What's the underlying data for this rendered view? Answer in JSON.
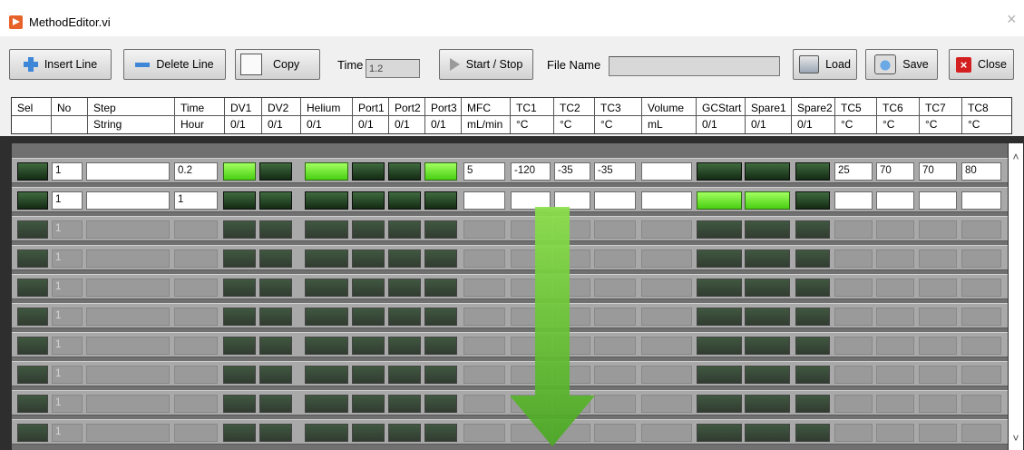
{
  "window": {
    "title": "MethodEditor.vi",
    "close_glyph": "×"
  },
  "toolbar": {
    "insert_line": "Insert Line",
    "delete_line": "Delete Line",
    "copy": "Copy",
    "time_label": "Time",
    "time_value": "1.2",
    "start_stop": "Start / Stop",
    "file_name_label": "File Name",
    "file_name_value": "",
    "load": "Load",
    "save": "Save",
    "close": "Close"
  },
  "icons": {
    "insert": "plus-icon",
    "delete": "minus-icon",
    "copy": "blank-square-icon",
    "start_stop": "play-triangle-icon",
    "load": "folder-icon",
    "save": "disk-save-icon",
    "close": "red-x-icon"
  },
  "columns": [
    {
      "name": "Sel",
      "unit": "",
      "kind": "led"
    },
    {
      "name": "No",
      "unit": "",
      "kind": "text"
    },
    {
      "name": "Step",
      "unit": "String",
      "kind": "text"
    },
    {
      "name": "Time",
      "unit": "Hour",
      "kind": "text"
    },
    {
      "name": "DV1",
      "unit": "0/1",
      "kind": "led"
    },
    {
      "name": "DV2",
      "unit": "0/1",
      "kind": "led"
    },
    {
      "name": "Helium",
      "unit": "0/1",
      "kind": "led"
    },
    {
      "name": "Port1",
      "unit": "0/1",
      "kind": "led"
    },
    {
      "name": "Port2",
      "unit": "0/1",
      "kind": "led"
    },
    {
      "name": "Port3",
      "unit": "0/1",
      "kind": "led"
    },
    {
      "name": "MFC",
      "unit": "mL/min",
      "kind": "text"
    },
    {
      "name": "TC1",
      "unit": "°C",
      "kind": "text"
    },
    {
      "name": "TC2",
      "unit": "°C",
      "kind": "text"
    },
    {
      "name": "TC3",
      "unit": "°C",
      "kind": "text"
    },
    {
      "name": "Volume",
      "unit": "mL",
      "kind": "text"
    },
    {
      "name": "GCStart",
      "unit": "0/1",
      "kind": "led"
    },
    {
      "name": "Spare1",
      "unit": "0/1",
      "kind": "led"
    },
    {
      "name": "Spare2",
      "unit": "0/1",
      "kind": "led"
    },
    {
      "name": "TC5",
      "unit": "°C",
      "kind": "text"
    },
    {
      "name": "TC6",
      "unit": "°C",
      "kind": "text"
    },
    {
      "name": "TC7",
      "unit": "°C",
      "kind": "text"
    },
    {
      "name": "TC8",
      "unit": "°C",
      "kind": "text"
    }
  ],
  "rows": [
    {
      "values": [
        0,
        "1",
        "",
        "0.2",
        1,
        0,
        1,
        0,
        0,
        1,
        "5",
        "-120",
        "-35",
        "-35",
        "",
        0,
        0,
        0,
        "25",
        "70",
        "70",
        "80"
      ],
      "active": true
    },
    {
      "values": [
        0,
        "1",
        "",
        "1",
        0,
        0,
        0,
        0,
        0,
        0,
        "",
        "",
        "",
        "",
        "",
        1,
        1,
        0,
        "",
        "",
        "",
        ""
      ],
      "active": true
    },
    {
      "values": [
        0,
        "1",
        "",
        "",
        0,
        0,
        0,
        0,
        0,
        0,
        "",
        "",
        "",
        "",
        "",
        0,
        0,
        0,
        "",
        "",
        "",
        ""
      ],
      "active": false
    },
    {
      "values": [
        0,
        "1",
        "",
        "",
        0,
        0,
        0,
        0,
        0,
        0,
        "",
        "",
        "",
        "",
        "",
        0,
        0,
        0,
        "",
        "",
        "",
        ""
      ],
      "active": false
    },
    {
      "values": [
        0,
        "1",
        "",
        "",
        0,
        0,
        0,
        0,
        0,
        0,
        "",
        "",
        "",
        "",
        "",
        0,
        0,
        0,
        "",
        "",
        "",
        ""
      ],
      "active": false
    },
    {
      "values": [
        0,
        "1",
        "",
        "",
        0,
        0,
        0,
        0,
        0,
        0,
        "",
        "",
        "",
        "",
        "",
        0,
        0,
        0,
        "",
        "",
        "",
        ""
      ],
      "active": false
    },
    {
      "values": [
        0,
        "1",
        "",
        "",
        0,
        0,
        0,
        0,
        0,
        0,
        "",
        "",
        "",
        "",
        "",
        0,
        0,
        0,
        "",
        "",
        "",
        ""
      ],
      "active": false
    },
    {
      "values": [
        0,
        "1",
        "",
        "",
        0,
        0,
        0,
        0,
        0,
        0,
        "",
        "",
        "",
        "",
        "",
        0,
        0,
        0,
        "",
        "",
        "",
        ""
      ],
      "active": false
    },
    {
      "values": [
        0,
        "1",
        "",
        "",
        0,
        0,
        0,
        0,
        0,
        0,
        "",
        "",
        "",
        "",
        "",
        0,
        0,
        0,
        "",
        "",
        "",
        ""
      ],
      "active": false
    },
    {
      "values": [
        0,
        "1",
        "",
        "",
        0,
        0,
        0,
        0,
        0,
        0,
        "",
        "",
        "",
        "",
        "",
        0,
        0,
        0,
        "",
        "",
        "",
        ""
      ],
      "active": false
    }
  ],
  "scrollbar": {
    "up_glyph": "˄",
    "down_glyph": "˅"
  },
  "colors": {
    "led_on": "#6be82a",
    "led_off": "#1f3a1f",
    "arrow": "#5cbf2a",
    "close_icon": "#d31f1f",
    "button_icon": "#3e87d8"
  }
}
